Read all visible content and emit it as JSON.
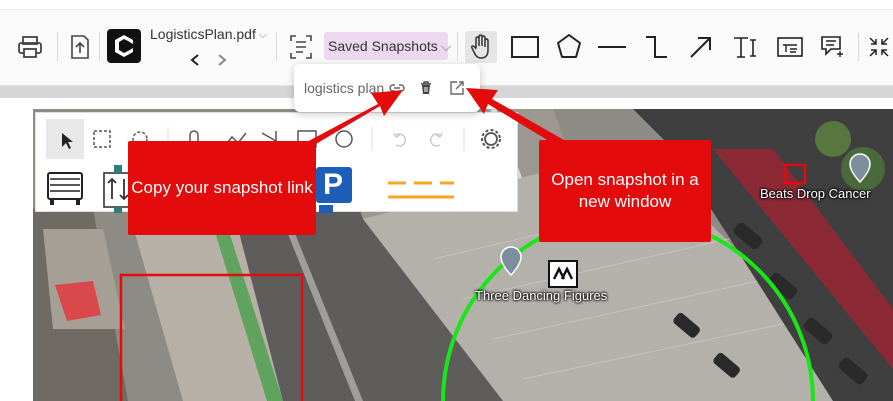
{
  "toolbar": {
    "file_name": "LogisticsPlan.pdf",
    "saved_snapshots_label": "Saved Snapshots",
    "icons": [
      "print-icon",
      "upload-icon",
      "app-logo-icon",
      "back-icon",
      "forward-icon",
      "snapshot-icon",
      "hand-icon",
      "rectangle-icon",
      "pentagon-icon",
      "line-icon",
      "elbow-line-icon",
      "arrow-icon",
      "text-icon",
      "textbox-icon",
      "callout-icon",
      "collapse-icon"
    ]
  },
  "popup": {
    "snapshot_name": "logistics plan",
    "icons": [
      "link-icon",
      "trash-icon",
      "open-external-icon"
    ]
  },
  "callouts": {
    "copy_link": "Copy your snapshot link",
    "open_window": "Open snapshot in a new window"
  },
  "map": {
    "labels": {
      "place_right": "Beats Drop Cancer",
      "place_center": "Three Dancing Figures"
    },
    "colors": {
      "callout": "#e30b0b",
      "circle": "#19e619",
      "dash": "#f5a623",
      "parking": "#1d5fb8"
    }
  },
  "panel": {
    "parking_letter": "P"
  }
}
